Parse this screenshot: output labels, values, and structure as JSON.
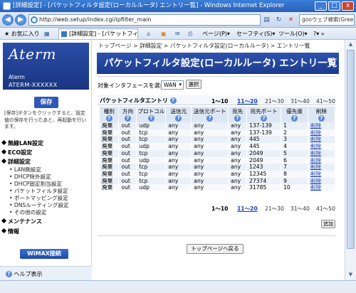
{
  "window": {
    "title": "[詳細設定] - [パケットフィルタ設定(ローカルルータ) エントリー覧] - Windows Internet Explorer",
    "controls": [
      "_",
      "□",
      "x"
    ]
  },
  "browser": {
    "url": "http://web.setup/index.cgi/ipfilter_main",
    "search_text": "gooウェブ検索(Green Label)",
    "favorites_label": "お気に入り",
    "tab_label": "[詳細設定] - [パケットフィルタ...",
    "cmd_page": "ページ(P)",
    "cmd_safety": "セーフティ(S)",
    "cmd_tools": "ツール(O)",
    "cmd_help": "?"
  },
  "sidebar": {
    "brand": "Aterm",
    "model_line1": "Aterm",
    "model_line2": "ATERM-XXXXXX",
    "save_label": "保存",
    "save_note": "[保存]ボタンをクリックすると、設定値の保存を行ったあと、再起動を行います。",
    "menu_wireless": "無線LAN設定",
    "menu_eco": "ECO設定",
    "menu_detail": "詳細設定",
    "sub_items": [
      "LAN側設定",
      "DHCP除外設定",
      "DHCP固定割当設定",
      "パケットフィルタ設定",
      "ポートマッピング設定",
      "DNSルーティング設定",
      "その他の設定"
    ],
    "menu_maintenance": "メンテナンス",
    "menu_info": "情報",
    "wimax_label": "WiMAX接続",
    "help_label": "ヘルプ表示"
  },
  "main": {
    "breadcrumb": "トップページ > 詳細設定 > パケットフィルタ設定(ローカルルータ) > エントリ一覧",
    "title": "パケットフィルタ設定(ローカルルータ) エントリ一覧",
    "interface_label": "対象インタフェースを選択",
    "interface_value": "WAN",
    "select_button": "選択",
    "section_title": "パケットフィルタエントリ",
    "pager": [
      "1～10",
      "11～20",
      "21～30",
      "31～40",
      "41～50"
    ],
    "columns": [
      "種別",
      "方向",
      "プロトコル",
      "送信元",
      "送信元ポート",
      "宛先",
      "宛先ポート",
      "優先度",
      "削除"
    ],
    "rows": [
      [
        "廃棄",
        "out",
        "udp",
        "any",
        "any",
        "any",
        "137-139",
        "1",
        "削除"
      ],
      [
        "廃棄",
        "out",
        "tcp",
        "any",
        "any",
        "any",
        "137-139",
        "2",
        "削除"
      ],
      [
        "廃棄",
        "out",
        "tcp",
        "any",
        "any",
        "any",
        "445",
        "3",
        "削除"
      ],
      [
        "廃棄",
        "out",
        "udp",
        "any",
        "any",
        "any",
        "445",
        "4",
        "削除"
      ],
      [
        "廃棄",
        "out",
        "tcp",
        "any",
        "any",
        "any",
        "2049",
        "5",
        "削除"
      ],
      [
        "廃棄",
        "out",
        "udp",
        "any",
        "any",
        "any",
        "2049",
        "6",
        "削除"
      ],
      [
        "廃棄",
        "out",
        "tcp",
        "any",
        "any",
        "any",
        "1243",
        "7",
        "削除"
      ],
      [
        "廃棄",
        "out",
        "tcp",
        "any",
        "any",
        "any",
        "12345",
        "8",
        "削除"
      ],
      [
        "廃棄",
        "out",
        "tcp",
        "any",
        "any",
        "any",
        "27374",
        "9",
        "削除"
      ],
      [
        "廃棄",
        "out",
        "udp",
        "any",
        "any",
        "any",
        "31785",
        "10",
        "削除"
      ]
    ],
    "add_button": "追加",
    "top_button": "トップページへ戻る"
  }
}
